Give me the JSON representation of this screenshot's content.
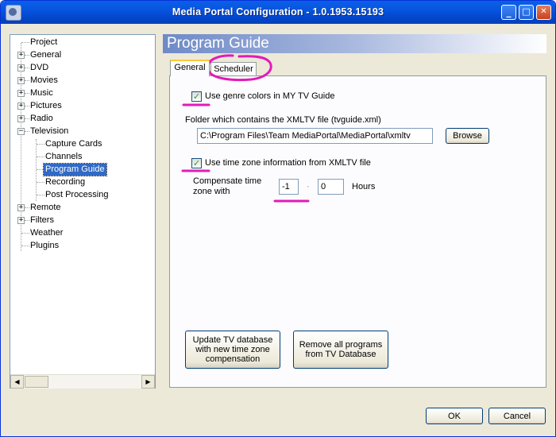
{
  "window": {
    "title": "Media Portal Configuration - 1.0.1953.15193",
    "minimize_glyph": "_",
    "maximize_glyph": "□",
    "close_glyph": "✕"
  },
  "tree": {
    "items": [
      {
        "label": "Project",
        "expander": ""
      },
      {
        "label": "General",
        "expander": "+"
      },
      {
        "label": "DVD",
        "expander": "+"
      },
      {
        "label": "Movies",
        "expander": "+"
      },
      {
        "label": "Music",
        "expander": "+"
      },
      {
        "label": "Pictures",
        "expander": "+"
      },
      {
        "label": "Radio",
        "expander": "+"
      },
      {
        "label": "Television",
        "expander": "−"
      },
      {
        "label": "Capture Cards",
        "expander": ""
      },
      {
        "label": "Channels",
        "expander": ""
      },
      {
        "label": "Program Guide",
        "expander": "",
        "selected": true
      },
      {
        "label": "Recording",
        "expander": ""
      },
      {
        "label": "Post Processing",
        "expander": ""
      },
      {
        "label": "Remote",
        "expander": "+"
      },
      {
        "label": "Filters",
        "expander": "+"
      },
      {
        "label": "Weather",
        "expander": ""
      },
      {
        "label": "Plugins",
        "expander": ""
      }
    ]
  },
  "page": {
    "title": "Program Guide",
    "tabs": [
      {
        "label": "General",
        "active": true
      },
      {
        "label": "Scheduler",
        "active": false
      }
    ]
  },
  "general": {
    "genre_colors_label": "Use genre colors in MY TV Guide",
    "genre_colors_checked": true,
    "folder_label": "Folder which contains the XMLTV file (tvguide.xml)",
    "folder_value": "C:\\Program Files\\Team MediaPortal\\MediaPortal\\xmltv",
    "browse_label": "Browse",
    "timezone_label": "Use time zone information from XMLTV file",
    "timezone_checked": true,
    "compensate_label_line1": "Compensate time",
    "compensate_label_line2": "zone with",
    "hours_value": "-1",
    "separator": "·",
    "minutes_value": "0",
    "hours_unit": "Hours",
    "update_db_line1": "Update TV database",
    "update_db_line2": "with new time zone",
    "update_db_line3": "compensation",
    "remove_line1": "Remove all programs",
    "remove_line2": "from TV Database"
  },
  "footer": {
    "ok_label": "OK",
    "cancel_label": "Cancel"
  },
  "annotation_color": "#e21bb8",
  "accent_colors": {
    "titlebar": "#0a5fe8",
    "selection": "#316ac5",
    "tab_highlight": "#ffc83c"
  }
}
